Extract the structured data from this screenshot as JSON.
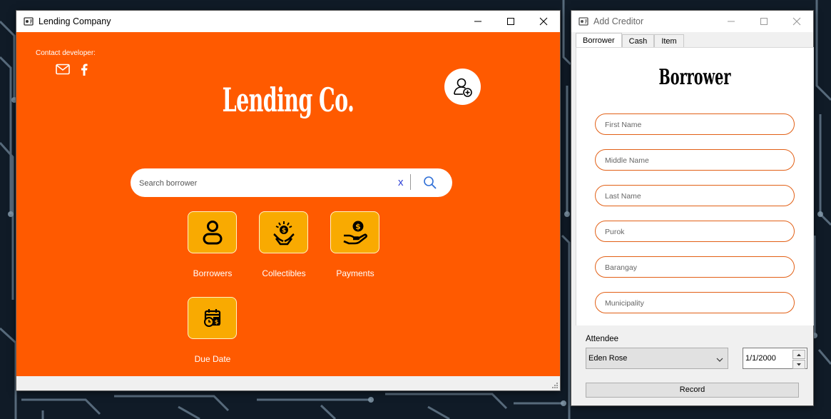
{
  "main_window": {
    "title": "Lending Company",
    "contact_label": "Contact developer:",
    "brand_title": "Lending Co.",
    "search": {
      "placeholder": "Search borrower",
      "clear_label": "x"
    },
    "tiles": [
      {
        "label": "Borrowers",
        "icon": "person-icon"
      },
      {
        "label": "Collectibles",
        "icon": "hand-coin-icon"
      },
      {
        "label": "Payments",
        "icon": "payment-hand-icon"
      },
      {
        "label": "Due Date",
        "icon": "calendar-clock-icon"
      }
    ]
  },
  "creditor_window": {
    "title": "Add Creditor",
    "tabs": [
      {
        "label": "Borrower",
        "active": true
      },
      {
        "label": "Cash",
        "active": false
      },
      {
        "label": "Item",
        "active": false
      }
    ],
    "panel_title": "Borrower",
    "fields": [
      {
        "placeholder": "First Name"
      },
      {
        "placeholder": "Middle Name"
      },
      {
        "placeholder": "Last Name"
      },
      {
        "placeholder": "Purok"
      },
      {
        "placeholder": "Barangay"
      },
      {
        "placeholder": "Municipality"
      }
    ],
    "attendee_label": "Attendee",
    "attendee_value": "Eden Rose",
    "date_value": "1/1/2000",
    "record_label": "Record"
  },
  "colors": {
    "accent_orange": "#ff5a00",
    "tile_yellow": "#f9aa01",
    "field_border": "#e26016"
  }
}
